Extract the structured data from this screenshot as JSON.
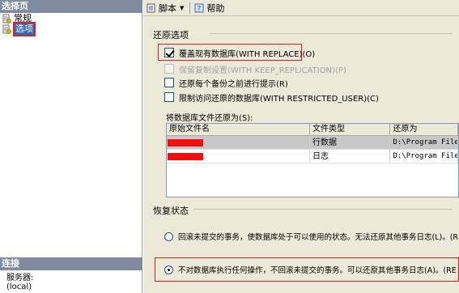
{
  "left_pane": {
    "select_page_header": "选择页",
    "items": [
      {
        "label": "常规",
        "icon": "page-icon"
      },
      {
        "label": "选项",
        "icon": "page-icon"
      }
    ],
    "connection_header": "连接",
    "server_label": "服务器:",
    "server_value": "(local)"
  },
  "toolbar": {
    "script_label": "脚本",
    "help_label": "帮助"
  },
  "restore_options": {
    "title": "还原选项",
    "overwrite": {
      "label": "覆盖现有数据库(WITH REPLACE)(O)",
      "checked": true
    },
    "keep_replication": {
      "label": "保留复制设置(WITH KEEP_REPLICATION)(P)",
      "checked": false,
      "disabled": true
    },
    "prompt": {
      "label": "还原每个备份之前进行提示(R)",
      "checked": false
    },
    "restrict": {
      "label": "限制访问还原的数据库(WITH RESTRICTED_USER)(C)",
      "checked": false
    }
  },
  "files": {
    "label": "将数据库文件还原为(S):",
    "columns": [
      "原始文件名",
      "文件类型",
      "还原为"
    ],
    "rows": [
      {
        "type": "行数据",
        "restore_as": "D:\\Program Files"
      },
      {
        "type": "日志",
        "restore_as": "D:\\Program Files"
      }
    ]
  },
  "recovery": {
    "title": "恢复状态",
    "norecovery_label": "回滚未提交的事务，使数据库处于可以使用的状态。无法还原其他事务日志(L)。(R",
    "recovery_label": "不对数据库执行任何操作，不回滚未提交的事务。可以还原其他事务日志(A)。(RE"
  },
  "colors": {
    "header_bg": "#7f8c9f",
    "pane_bg": "#ece9d8",
    "highlight": "#e02020",
    "selection": "#316ac5"
  }
}
